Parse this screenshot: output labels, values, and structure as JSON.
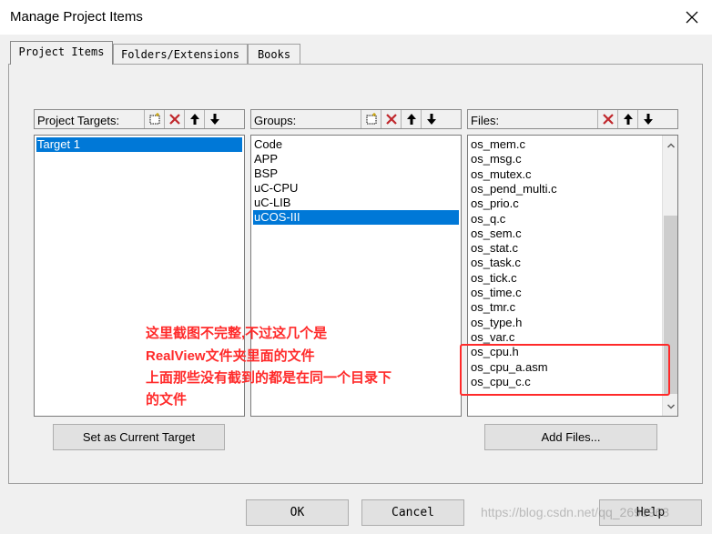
{
  "window": {
    "title": "Manage Project Items"
  },
  "tabs": [
    {
      "label": "Project Items",
      "active": true
    },
    {
      "label": "Folders/Extensions",
      "active": false
    },
    {
      "label": "Books",
      "active": false
    }
  ],
  "targets": {
    "label": "Project Targets:",
    "items": [
      {
        "text": "Target 1",
        "selected": true
      }
    ]
  },
  "groups": {
    "label": "Groups:",
    "items": [
      {
        "text": "Code",
        "selected": false
      },
      {
        "text": "APP",
        "selected": false
      },
      {
        "text": "BSP",
        "selected": false
      },
      {
        "text": "uC-CPU",
        "selected": false
      },
      {
        "text": "uC-LIB",
        "selected": false
      },
      {
        "text": "uCOS-III",
        "selected": true
      }
    ]
  },
  "files": {
    "label": "Files:",
    "items": [
      "os_mem.c",
      "os_msg.c",
      "os_mutex.c",
      "os_pend_multi.c",
      "os_prio.c",
      "os_q.c",
      "os_sem.c",
      "os_stat.c",
      "os_task.c",
      "os_tick.c",
      "os_time.c",
      "os_tmr.c",
      "os_type.h",
      "os_var.c",
      "os_cpu.h",
      "os_cpu_a.asm",
      "os_cpu_c.c"
    ]
  },
  "buttons": {
    "set_current": "Set as Current Target",
    "add_files": "Add Files...",
    "ok": "OK",
    "cancel": "Cancel",
    "help": "Help"
  },
  "annotation": {
    "lines": [
      "这里截图不完整,不过这几个是",
      "RealView文件夹里面的文件",
      "上面那些没有截到的都是在同一个目录下",
      "的文件"
    ],
    "color": "#ff2a2a"
  },
  "watermark": "https://blog.csdn.net/qq_2691963",
  "colors": {
    "selection": "#0078d7",
    "delete_icon": "#c0282d"
  },
  "icons": [
    "new-item-icon",
    "delete-icon",
    "move-up-icon",
    "move-down-icon",
    "close-icon"
  ]
}
